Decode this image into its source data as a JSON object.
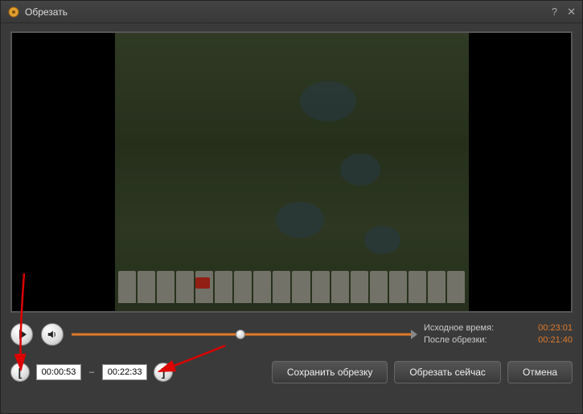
{
  "window": {
    "title": "Обрезать"
  },
  "playback": {
    "slider_position_percent": 49
  },
  "time_info": {
    "source_label": "Исходное время:",
    "source_value": "00:23:01",
    "after_label": "После обрезки:",
    "after_value": "00:21:40"
  },
  "trim": {
    "start_time": "00:00:53",
    "end_time": "00:22:33"
  },
  "buttons": {
    "save": "Сохранить обрезку",
    "trim_now": "Обрезать сейчас",
    "cancel": "Отмена"
  },
  "icons": {
    "bracket_open": "[",
    "bracket_close": "]",
    "dash": "–"
  }
}
